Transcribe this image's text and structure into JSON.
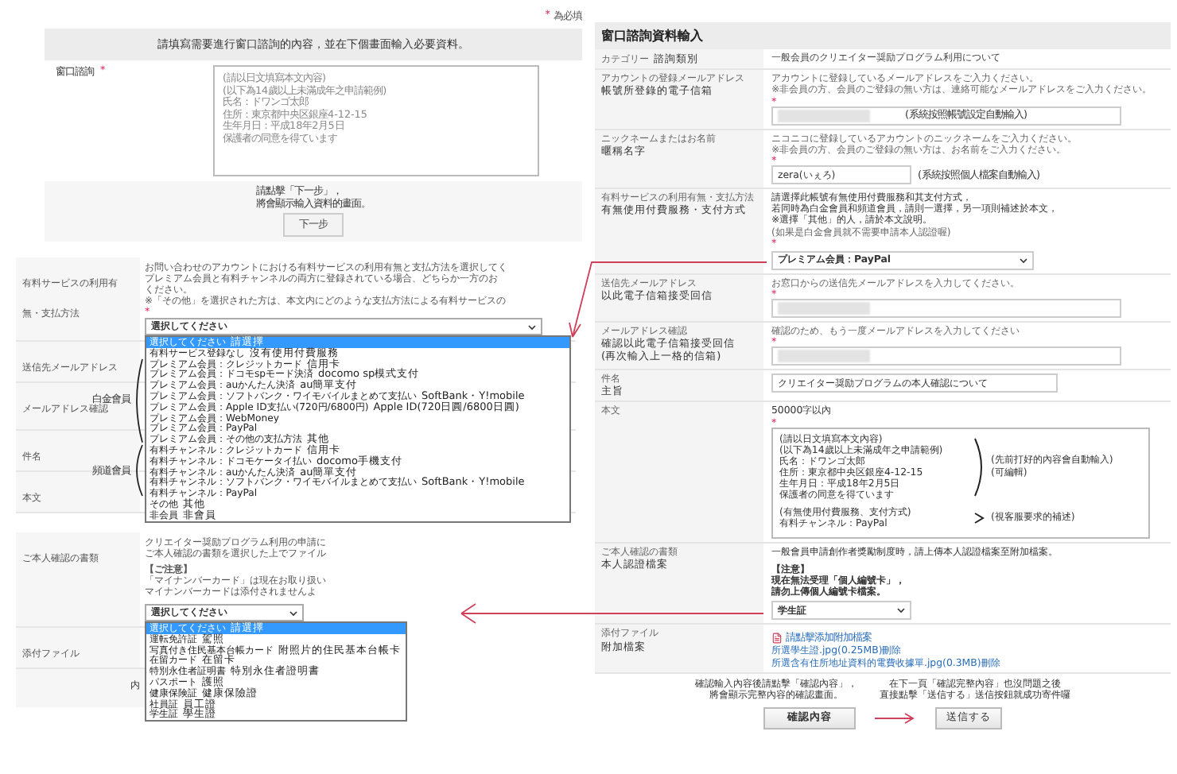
{
  "required_note": {
    "mark": "*",
    "text": "為必填"
  },
  "inquiry": {
    "header": "請填寫需要進行窗口諮詢的內容，並在下個畫面輸入必要資料。",
    "label": "窗口諮詢",
    "required_mark": "*",
    "placeholder": [
      "(請以日文填寫本文內容)",
      "(以下為14歲以上未滿成年之申請範例)",
      "氏名：ドワンゴ太郎",
      "住所：東京都中央区銀座4-12-15",
      "生年月日：平成18年2月5日",
      "保護者の同意を得ています"
    ],
    "instruction": [
      "請點擊「下一步」，",
      "將會顯示輸入資料的畫面。"
    ],
    "button": "下一步"
  },
  "payment_screenshot": {
    "rows": [
      {
        "label": "有料サービスの利用有無・支払方法"
      },
      {
        "label": "送信先メールアドレス"
      },
      {
        "label": "メールアドレス確認"
      },
      {
        "label": "件名"
      },
      {
        "label": "本文"
      }
    ],
    "notes": [
      "お問い合わせのアカウントにおける有料サービスの利用有無と支払方法を選択してく",
      "プレミアム会員と有料チャンネルの両方に登録されている場合、どちらか一方のお",
      "ください。",
      "※「その他」を選択された方は、本文内にどのような支払方法による有料サービスの"
    ],
    "required_mark": "*",
    "select": "選択してください",
    "options": [
      {
        "text": "選択してください",
        "note": "請選擇",
        "selected": true
      },
      {
        "text": "有料サービス登録なし",
        "note": "沒有使用付費服務",
        "selected": false
      },
      {
        "text": "プレミアム会員：クレジットカード",
        "note": "信用卡",
        "selected": false
      },
      {
        "text": "プレミアム会員：ドコモspモード決済",
        "note": "docomo sp模式支付",
        "selected": false
      },
      {
        "text": "プレミアム会員：auかんたん決済",
        "note": "au簡單支付",
        "selected": false
      },
      {
        "text": "プレミアム会員：ソフトバンク・ワイモバイルまとめて支払い",
        "note": "SoftBank・Y!mobile",
        "selected": false
      },
      {
        "text": "プレミアム会員：Apple ID支払い(720円/6800円)",
        "note": "Apple ID(720日圓/6800日圓)",
        "selected": false
      },
      {
        "text": "プレミアム会員：WebMoney",
        "selected": false
      },
      {
        "text": "プレミアム会員：PayPal",
        "selected": false
      },
      {
        "text": "プレミアム会員：その他の支払方法",
        "note": "其他",
        "selected": false
      },
      {
        "text": "有料チャンネル：クレジットカード",
        "note": "信用卡",
        "selected": false
      },
      {
        "text": "有料チャンネル：ドコモケータイ払い",
        "note": "docomo手機支付",
        "selected": false
      },
      {
        "text": "有料チャンネル：auかんたん決済",
        "note": "au簡單支付",
        "selected": false
      },
      {
        "text": "有料チャンネル：ソフトバンク・ワイモバイルまとめて支払い",
        "note": "SoftBank・Y!mobile",
        "selected": false
      },
      {
        "text": "有料チャンネル：PayPal",
        "selected": false
      },
      {
        "text": "その他",
        "note": "其他",
        "selected": false
      },
      {
        "text": "非会員",
        "note": "非會員",
        "selected": false
      }
    ],
    "groups": [
      {
        "label": "白金會員"
      },
      {
        "label": "頻道會員"
      }
    ]
  },
  "id_screenshot": {
    "rows": [
      {
        "label": "ご本人確認の書類"
      },
      {
        "label": "添付ファイル"
      }
    ],
    "notes": [
      {
        "kind": "normal",
        "text": "クリエイター奨励プログラム利用の申請に"
      },
      {
        "kind": "normal",
        "text": "ご本人確認の書類を選択した上でファイル"
      },
      {
        "kind": "heading",
        "text": "【ご注意】"
      },
      {
        "kind": "normal",
        "text": "「マイナンバーカード」は現在お取り扱い"
      },
      {
        "kind": "normal",
        "text": "マイナンバーカードは添付されませんよ"
      }
    ],
    "select": "選択してください",
    "options": [
      {
        "text": "選択してください",
        "note": "請選擇",
        "selected": true
      },
      {
        "text": "運転免許証",
        "note": "駕照",
        "selected": false
      },
      {
        "text": "写真付き住民基本台帳カード",
        "note": "附照片的住民基本台帳卡",
        "selected": false
      },
      {
        "text": "在留カード",
        "note": "在留卡",
        "selected": false
      },
      {
        "text": "特別永住者証明書",
        "note": "特別永住者證明書",
        "selected": false
      },
      {
        "text": "パスポート",
        "note": "護照",
        "selected": false
      },
      {
        "text": "健康保険証",
        "note": "健康保險證",
        "selected": false
      },
      {
        "text": "社員証",
        "note": "員工證",
        "selected": false
      },
      {
        "text": "学生証",
        "note": "學生證",
        "selected": false
      }
    ],
    "fragment": "内"
  },
  "form": {
    "title": "窗口諮詢資料輸入",
    "rows": [
      {
        "kind": "text",
        "label_jp": "カテゴリー",
        "label_zh": [
          "諮詢類別"
        ],
        "value": "一般会員のクリエイター奨励プログラム利用について"
      },
      {
        "kind": "input",
        "label_jp": "アカウントの登録メールアドレス",
        "label_zh": [
          "帳號所登錄的電子信箱"
        ],
        "notes": [
          {
            "kind": "small",
            "text": "アカウントに登録しているメールアドレスをご入力ください。"
          },
          {
            "kind": "small",
            "text": "※非会員の方、会員のご登録の無い方は、連絡可能なメールアドレスをご入力ください。"
          }
        ],
        "required_mark": "*",
        "redacted": true,
        "hint": "(系統按照帳號設定自動輸入)",
        "hint_inside": true
      },
      {
        "kind": "input",
        "label_jp": "ニックネームまたはお名前",
        "label_zh": [
          "暱稱名字"
        ],
        "notes": [
          {
            "kind": "small",
            "text": "ニコニコに登録しているアカウントのニックネームをご入力ください。"
          },
          {
            "kind": "small",
            "text": "※非会員の方、会員のご登録の無い方は、お名前をご入力ください。"
          }
        ],
        "required_mark": "*",
        "value": "zera(いぇろ)",
        "hint": "(系統按照個人檔案自動輸入)",
        "hint_inside": false
      },
      {
        "kind": "select",
        "label_jp": "有料サービスの利用有無・支払方法",
        "label_zh": [
          "有無使用付費服務・支付方式"
        ],
        "notes": [
          {
            "kind": "normal",
            "text": "請選擇此帳號有無使用付費服務和其支付方式，"
          },
          {
            "kind": "normal",
            "text": "若同時為白金會員和頻道會員，請則一選擇，另一項則補述於本文，"
          },
          {
            "kind": "normal",
            "text": "※選擇「其他」的人，請於本文說明。"
          },
          {
            "kind": "small",
            "text": "(如果是白金會員就不需要申請本人認證喔)"
          }
        ],
        "required_mark": "*",
        "value": "プレミアム会員：PayPal"
      },
      {
        "kind": "input",
        "label_jp": "送信先メールアドレス",
        "label_zh": [
          "以此電子信箱接受回信"
        ],
        "notes": [
          {
            "kind": "small",
            "text": "お窓口からの送信先メールアドレスを入力してください。"
          }
        ],
        "required_mark": "*",
        "redacted": true
      },
      {
        "kind": "input",
        "label_jp": "メールアドレス確認",
        "label_zh": [
          "確認以此電子信箱接受回信",
          "(再次輸入上一格的信箱)"
        ],
        "notes": [
          {
            "kind": "small",
            "text": "確認のため、もう一度メールアドレスを入力してください"
          }
        ],
        "required_mark": "*",
        "redacted": true
      },
      {
        "kind": "input",
        "label_jp": "件名",
        "label_zh": [
          "主旨"
        ],
        "value": "クリエイター奨励プログラムの本人確認について"
      },
      {
        "kind": "textarea",
        "label_jp": "本文",
        "notes": [
          {
            "kind": "normal",
            "text": "50000字以內"
          }
        ],
        "required_mark": "*",
        "blocks": [
          {
            "lines": [
              "(請以日文填寫本文內容)",
              "(以下為14歲以上未滿成年之申請範例)",
              "氏名：ドワンゴ太郎",
              "住所：東京都中央区銀座4-12-15",
              "生年月日：平成18年2月5日",
              "保護者の同意を得ています"
            ],
            "kind": "brace",
            "annotation": [
              "(先前打好的內容會自動輸入)",
              "(可編輯)"
            ]
          },
          {
            "lines": [
              "(有無使用付費服務、支付方式)",
              "有料チャンネル：PayPal"
            ],
            "kind": "angle",
            "annotation": [
              "(視客服要求的補述)"
            ]
          }
        ]
      },
      {
        "kind": "select",
        "label_jp": "ご本人確認の書類",
        "label_zh": [
          "本人認證檔案"
        ],
        "notes": [
          {
            "kind": "normal",
            "text": "一般會員申請創作者獎勵制度時，請上傳本人認證檔案至附加檔案。"
          },
          {
            "kind": "heading",
            "text": "【注意】"
          },
          {
            "kind": "bold",
            "text": "現在無法受理「個人編號卡」，"
          },
          {
            "kind": "bold",
            "text": "請勿上傳個人編號卡檔案。"
          }
        ],
        "value": "学生証"
      },
      {
        "kind": "file",
        "label_jp": "添付ファイル",
        "label_zh": [
          "附加檔案"
        ],
        "link": "請點擊添加附加檔案",
        "files": [
          "所選學生證.jpg(0.25MB)刪除",
          "所選含有住所地址資料的電費收據單.jpg(0.3MB)刪除"
        ]
      }
    ],
    "footer": {
      "left": [
        "確認輸入內容後請點擊「確認內容」，",
        "將會顯示完整內容的確認畫面。"
      ],
      "right": [
        "在下一頁「確認完整內容」也沒問題之後",
        "直接點擊「送信する」送信按鈕就成功寄件囉"
      ],
      "confirm_button": "確認內容",
      "send_button": "送信する"
    }
  }
}
